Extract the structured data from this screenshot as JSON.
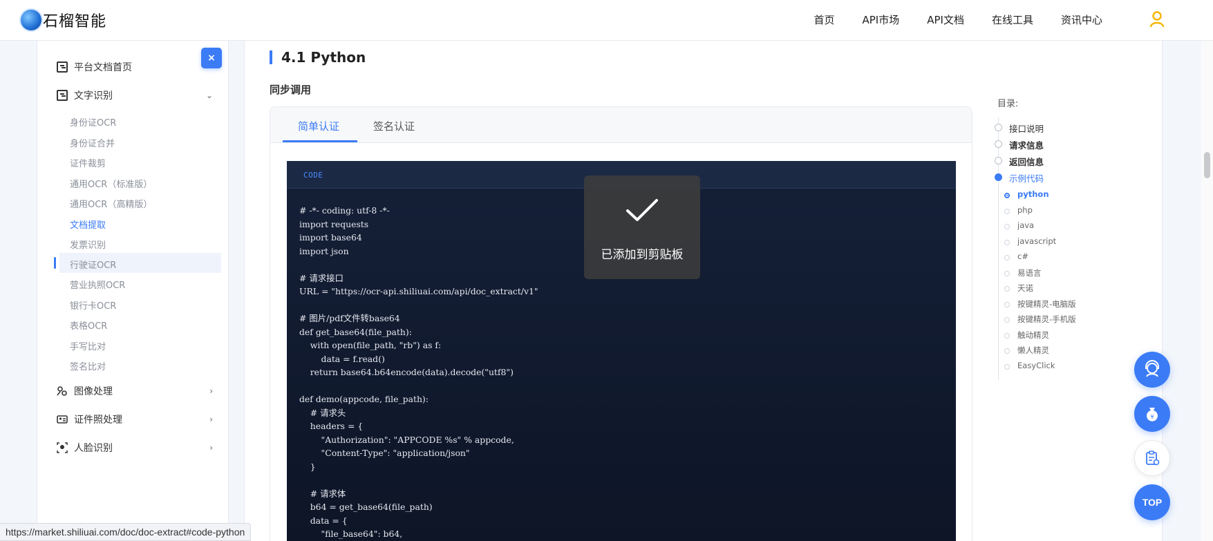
{
  "app": {
    "logo_text": "石榴智能"
  },
  "nav": {
    "items": [
      "首页",
      "API市场",
      "API文档",
      "在线工具",
      "资讯中心"
    ]
  },
  "sidebar": {
    "collapse_label": "×",
    "home": "平台文档首页",
    "groups": [
      {
        "label": "文字识别",
        "expanded": true
      },
      {
        "label": "图像处理",
        "expanded": false
      },
      {
        "label": "证件照处理",
        "expanded": false
      },
      {
        "label": "人脸识别",
        "expanded": false
      }
    ],
    "sub_items": [
      "身份证OCR",
      "身份证合并",
      "证件裁剪",
      "通用OCR（标准版）",
      "通用OCR（高精版）",
      "文档提取",
      "发票识别",
      "行驶证OCR",
      "营业执照OCR",
      "银行卡OCR",
      "表格OCR",
      "手写比对",
      "签名比对"
    ],
    "active_sub": "文档提取"
  },
  "main": {
    "section_title": "4.1 Python",
    "subsection_title": "同步调用",
    "tabs": [
      "简单认证",
      "签名认证"
    ],
    "active_tab": "简单认证",
    "code_tag": "CODE",
    "code_lines": [
      "# -*- coding: utf-8 -*-",
      "import requests",
      "import base64",
      "import json",
      "",
      "# 请求接口",
      "URL = \"https://ocr-api.shiliuai.com/api/doc_extract/v1\"",
      "",
      "# 图片/pdf文件转base64",
      "def get_base64(file_path):",
      "    with open(file_path, \"rb\") as f:",
      "        data = f.read()",
      "    return base64.b64encode(data).decode(\"utf8\")",
      "",
      "def demo(appcode, file_path):",
      "    # 请求头",
      "    headers = {",
      "        \"Authorization\": \"APPCODE %s\" % appcode,",
      "        \"Content-Type\": \"application/json\"",
      "    }",
      "",
      "    # 请求体",
      "    b64 = get_base64(file_path)",
      "    data = {",
      "        \"file_base64\": b64,"
    ]
  },
  "toast": {
    "message": "已添加到剪贴板"
  },
  "toc": {
    "label": "目录:",
    "items": [
      "接口说明",
      "请求信息",
      "返回信息",
      "示例代码"
    ],
    "active_item": "示例代码",
    "sub_items": [
      "python",
      "php",
      "java",
      "javascript",
      "c#",
      "易语言",
      "天诺",
      "按键精灵-电脑版",
      "按键精灵-手机版",
      "触动精灵",
      "懒人精灵",
      "EasyClick"
    ],
    "active_sub": "python"
  },
  "floating": {
    "top_label": "TOP"
  },
  "status_bar": {
    "url": "https://market.shiliuai.com/doc/doc-extract#code-python"
  },
  "colors": {
    "accent": "#3b7bf6",
    "code_bg": "#111b30",
    "toast_bg": "#3c3c3c"
  }
}
